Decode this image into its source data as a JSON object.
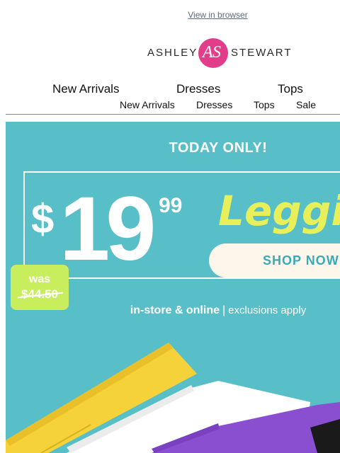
{
  "header": {
    "view_in_browser": "View in browser"
  },
  "brand": {
    "word_left": "ASHLEY",
    "word_right": "STEWART",
    "monogram_a": "A",
    "monogram_s": "S",
    "accent_color": "#e23d8a"
  },
  "nav_primary": [
    "New Arrivals",
    "Dresses",
    "Tops"
  ],
  "nav_secondary": [
    "New Arrivals",
    "Dresses",
    "Tops",
    "Sale"
  ],
  "hero": {
    "background": "#58bec8",
    "headline": "TODAY ONLY!",
    "price_symbol": "$",
    "price_whole": "19",
    "price_cents": "99",
    "product": "Leggin",
    "cta": "SHOP NOW",
    "was_label": "was",
    "was_price": "$44.50",
    "availability_bold": "in-store & online",
    "availability_sep": "|",
    "availability_note": "exclusions apply",
    "legging_colors": [
      "#f5d23a",
      "#ffffff",
      "#8a4fd0"
    ]
  }
}
